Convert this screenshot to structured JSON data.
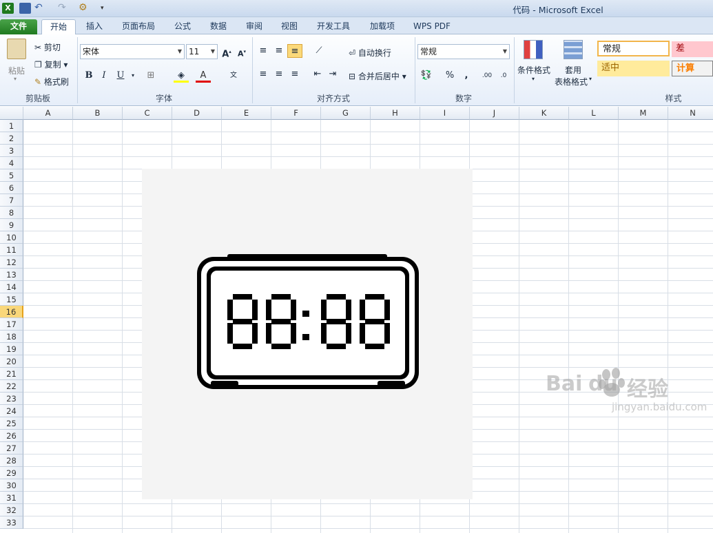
{
  "window": {
    "title": "代码 - Microsoft Excel"
  },
  "tabs": [
    {
      "label": "文件"
    },
    {
      "label": "开始"
    },
    {
      "label": "插入"
    },
    {
      "label": "页面布局"
    },
    {
      "label": "公式"
    },
    {
      "label": "数据"
    },
    {
      "label": "审阅"
    },
    {
      "label": "视图"
    },
    {
      "label": "开发工具"
    },
    {
      "label": "加载项"
    },
    {
      "label": "WPS PDF"
    }
  ],
  "ribbon": {
    "clipboard": {
      "paste": "粘贴",
      "cut": "剪切",
      "copy": "复制",
      "format_painter": "格式刷",
      "label": "剪贴板"
    },
    "font": {
      "name": "宋体",
      "size": "11",
      "label": "字体"
    },
    "alignment": {
      "wrap": "自动换行",
      "merge": "合并后居中",
      "label": "对齐方式"
    },
    "number": {
      "format": "常规",
      "label": "数字"
    },
    "styles": {
      "conditional": "条件格式",
      "table_top": "套用",
      "table_bottom": "表格格式",
      "normal": "常规",
      "bad": "差",
      "neutral": "适中",
      "calc": "计算",
      "label": "样式"
    }
  },
  "sheet": {
    "columns": [
      "A",
      "B",
      "C",
      "D",
      "E",
      "F",
      "G",
      "H",
      "I",
      "J",
      "K",
      "L",
      "M",
      "N"
    ],
    "rows": [
      "1",
      "2",
      "3",
      "4",
      "5",
      "6",
      "7",
      "8",
      "9",
      "10",
      "11",
      "12",
      "13",
      "14",
      "15",
      "16",
      "17",
      "18",
      "19",
      "20",
      "21",
      "22",
      "23",
      "24",
      "25",
      "26",
      "27",
      "28",
      "29",
      "30",
      "31",
      "32",
      "33"
    ],
    "selected_row": "16"
  },
  "clock": {
    "digits": "88:88"
  },
  "watermark": {
    "brand": "Bai",
    "brand2": "du",
    "suffix": "经验",
    "url": "jingyan.baidu.com"
  },
  "colors": {
    "bad_bg": "#ffc7ce",
    "neutral_bg": "#ffeb9c",
    "calc_bg": "#f2f2f2",
    "file_tab": "#2a8a2a"
  }
}
